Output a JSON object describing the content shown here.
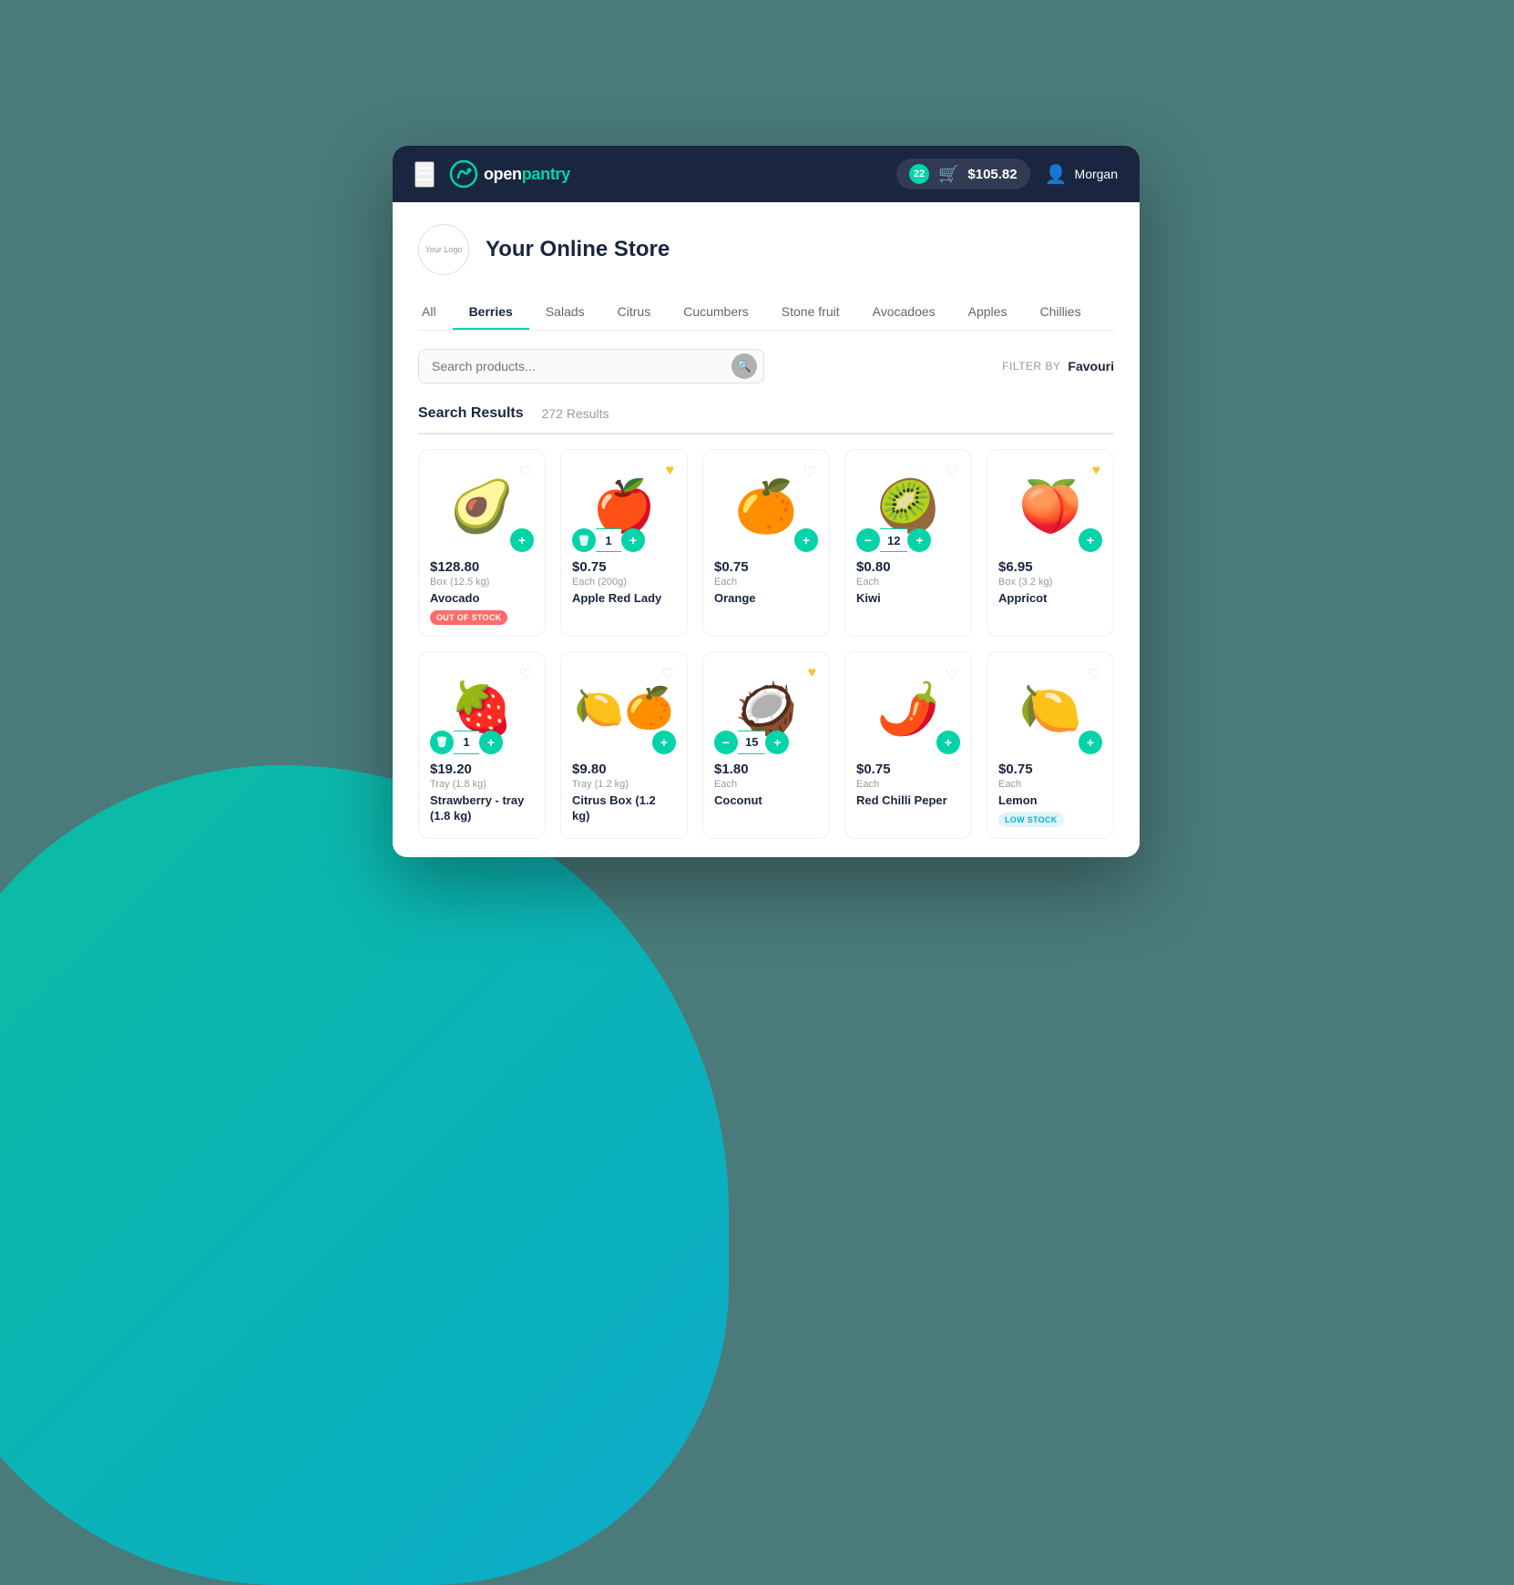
{
  "header": {
    "hamburger_label": "☰",
    "logo_text_open": "open",
    "logo_text_pantry": "pantry",
    "cart_count": "22",
    "cart_price": "$105.82",
    "user_name": "Morgan"
  },
  "store": {
    "logo_text": "Your Logo",
    "title": "Your Online Store"
  },
  "categories": [
    {
      "label": "All",
      "active": false
    },
    {
      "label": "Berries",
      "active": true
    },
    {
      "label": "Salads",
      "active": false
    },
    {
      "label": "Citrus",
      "active": false
    },
    {
      "label": "Cucumbers",
      "active": false
    },
    {
      "label": "Stone fruit",
      "active": false
    },
    {
      "label": "Avocadoes",
      "active": false
    },
    {
      "label": "Apples",
      "active": false
    },
    {
      "label": "Chillies",
      "active": false
    }
  ],
  "search": {
    "placeholder": "Search products...",
    "filter_label": "FILTER BY",
    "filter_value": "Favouri"
  },
  "results": {
    "title": "Search Results",
    "count": "272 Results"
  },
  "products_row1": [
    {
      "emoji": "🥑",
      "price": "$128.80",
      "unit": "Box (12.5 kg)",
      "name": "Avocado",
      "status": "OUT OF STOCK",
      "status_type": "out-of-stock",
      "favorited": false,
      "qty": 0,
      "has_add": true
    },
    {
      "emoji": "🍎",
      "price": "$0.75",
      "unit": "Each (200g)",
      "name": "Apple Red Lady",
      "status": "",
      "status_type": "",
      "favorited": true,
      "qty": 1,
      "has_add": true
    },
    {
      "emoji": "🍊",
      "price": "$0.75",
      "unit": "Each",
      "name": "Orange",
      "status": "",
      "status_type": "",
      "favorited": false,
      "qty": 0,
      "has_add": true
    },
    {
      "emoji": "🥝",
      "price": "$0.80",
      "unit": "Each",
      "name": "Kiwi",
      "status": "",
      "status_type": "",
      "favorited": false,
      "qty": 12,
      "has_add": true
    },
    {
      "emoji": "🍑",
      "price": "$6.95",
      "unit": "Box (3.2 kg)",
      "name": "Appricot",
      "status": "",
      "status_type": "",
      "favorited": true,
      "qty": 0,
      "has_add": true
    }
  ],
  "products_row2": [
    {
      "emoji": "🍓",
      "price": "$19.20",
      "unit": "Tray (1.8 kg)",
      "name": "Strawberry - tray (1.8 kg)",
      "status": "",
      "status_type": "",
      "favorited": false,
      "qty": 1,
      "has_add": true
    },
    {
      "emoji": "🍋",
      "price": "$9.80",
      "unit": "Tray (1.2 kg)",
      "name": "Citrus Box (1.2 kg)",
      "status": "",
      "status_type": "",
      "favorited": false,
      "qty": 0,
      "has_add": true
    },
    {
      "emoji": "🥥",
      "price": "$1.80",
      "unit": "Each",
      "name": "Coconut",
      "status": "",
      "status_type": "",
      "favorited": true,
      "qty": 15,
      "has_add": true
    },
    {
      "emoji": "🌶️",
      "price": "$0.75",
      "unit": "Each",
      "name": "Red Chilli Peper",
      "status": "",
      "status_type": "",
      "favorited": false,
      "qty": 0,
      "has_add": true
    },
    {
      "emoji": "🍋",
      "price": "$0.75",
      "unit": "Each",
      "name": "Lemon",
      "status": "LOW STOCK",
      "status_type": "low-stock",
      "favorited": false,
      "qty": 0,
      "has_add": true
    }
  ]
}
